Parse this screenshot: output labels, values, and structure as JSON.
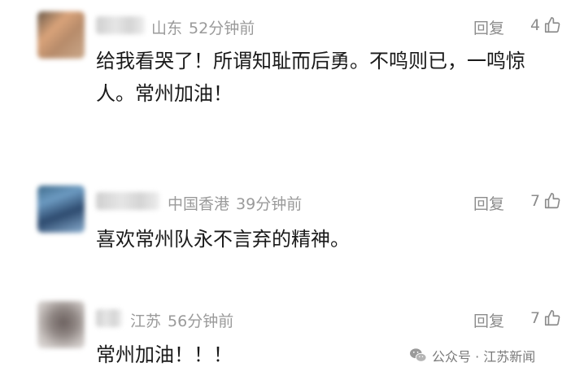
{
  "comments": [
    {
      "location": "山东",
      "time": "52分钟前",
      "reply_label": "回复",
      "likes": "4",
      "text": "给我看哭了！所谓知耻而后勇。不鸣则已，一鸣惊人。常州加油！"
    },
    {
      "location": "中国香港",
      "time": "39分钟前",
      "reply_label": "回复",
      "likes": "7",
      "text": "喜欢常州队永不言弃的精神。"
    },
    {
      "location": "江苏",
      "time": "56分钟前",
      "reply_label": "回复",
      "likes": "7",
      "text": "常州加油！！！"
    }
  ],
  "watermark": {
    "icon": "wechat-icon",
    "text": "公众号 · 江苏新闻"
  }
}
